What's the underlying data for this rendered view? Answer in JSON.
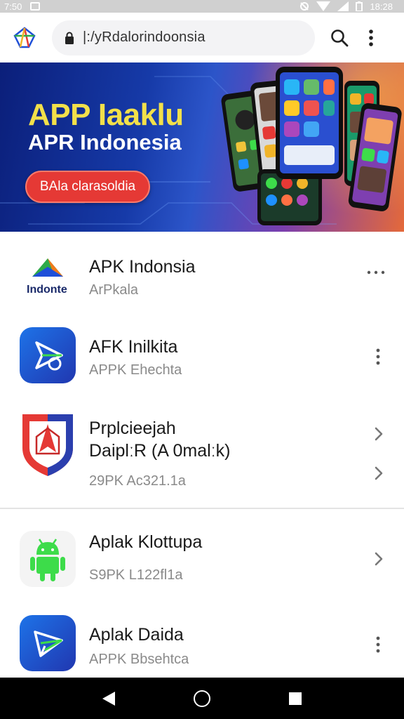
{
  "status_bar": {
    "time": "7:50",
    "clock": "18:28"
  },
  "address_bar": {
    "url": "|:/yRdalorindoonsia"
  },
  "banner": {
    "title": "APP Iaaklu",
    "subtitle": "APR Indonesia",
    "button_label": "BAla clarasoldia"
  },
  "apps": [
    {
      "title": "APK Indonsia",
      "subtitle": "ArPkala",
      "icon_label": "Indonte",
      "action": "more-horizontal"
    },
    {
      "title": "AFK Inilkita",
      "subtitle": "APPK Ehechta",
      "action": "more-vertical"
    },
    {
      "title": "Prplcieejah",
      "title2": "DaiplːR (A 0malːk)",
      "subtitle": "29PK Ac321.1a",
      "action": "chevron-right"
    },
    {
      "title": "Aplak Klottupa",
      "subtitle": "S9PK L122fl1a",
      "action": "chevron-right"
    },
    {
      "title": "Aplak Daida",
      "subtitle": "APPK Bbsehtca",
      "action": "more-vertical"
    }
  ],
  "colors": {
    "accent_red": "#e53935",
    "banner_yellow": "#f2e04a",
    "android_green": "#3ddc4a",
    "icon_blue": "#1e4fd8"
  }
}
